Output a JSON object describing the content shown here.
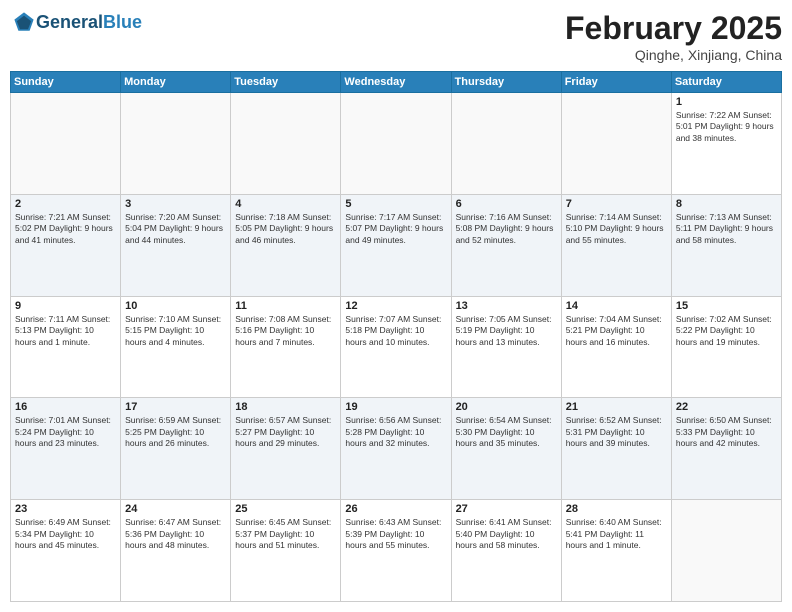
{
  "header": {
    "logo_general": "General",
    "logo_blue": "Blue",
    "month_title": "February 2025",
    "location": "Qinghe, Xinjiang, China"
  },
  "weekdays": [
    "Sunday",
    "Monday",
    "Tuesday",
    "Wednesday",
    "Thursday",
    "Friday",
    "Saturday"
  ],
  "weeks": [
    [
      {
        "day": "",
        "info": ""
      },
      {
        "day": "",
        "info": ""
      },
      {
        "day": "",
        "info": ""
      },
      {
        "day": "",
        "info": ""
      },
      {
        "day": "",
        "info": ""
      },
      {
        "day": "",
        "info": ""
      },
      {
        "day": "1",
        "info": "Sunrise: 7:22 AM\nSunset: 5:01 PM\nDaylight: 9 hours and 38 minutes."
      }
    ],
    [
      {
        "day": "2",
        "info": "Sunrise: 7:21 AM\nSunset: 5:02 PM\nDaylight: 9 hours and 41 minutes."
      },
      {
        "day": "3",
        "info": "Sunrise: 7:20 AM\nSunset: 5:04 PM\nDaylight: 9 hours and 44 minutes."
      },
      {
        "day": "4",
        "info": "Sunrise: 7:18 AM\nSunset: 5:05 PM\nDaylight: 9 hours and 46 minutes."
      },
      {
        "day": "5",
        "info": "Sunrise: 7:17 AM\nSunset: 5:07 PM\nDaylight: 9 hours and 49 minutes."
      },
      {
        "day": "6",
        "info": "Sunrise: 7:16 AM\nSunset: 5:08 PM\nDaylight: 9 hours and 52 minutes."
      },
      {
        "day": "7",
        "info": "Sunrise: 7:14 AM\nSunset: 5:10 PM\nDaylight: 9 hours and 55 minutes."
      },
      {
        "day": "8",
        "info": "Sunrise: 7:13 AM\nSunset: 5:11 PM\nDaylight: 9 hours and 58 minutes."
      }
    ],
    [
      {
        "day": "9",
        "info": "Sunrise: 7:11 AM\nSunset: 5:13 PM\nDaylight: 10 hours and 1 minute."
      },
      {
        "day": "10",
        "info": "Sunrise: 7:10 AM\nSunset: 5:15 PM\nDaylight: 10 hours and 4 minutes."
      },
      {
        "day": "11",
        "info": "Sunrise: 7:08 AM\nSunset: 5:16 PM\nDaylight: 10 hours and 7 minutes."
      },
      {
        "day": "12",
        "info": "Sunrise: 7:07 AM\nSunset: 5:18 PM\nDaylight: 10 hours and 10 minutes."
      },
      {
        "day": "13",
        "info": "Sunrise: 7:05 AM\nSunset: 5:19 PM\nDaylight: 10 hours and 13 minutes."
      },
      {
        "day": "14",
        "info": "Sunrise: 7:04 AM\nSunset: 5:21 PM\nDaylight: 10 hours and 16 minutes."
      },
      {
        "day": "15",
        "info": "Sunrise: 7:02 AM\nSunset: 5:22 PM\nDaylight: 10 hours and 19 minutes."
      }
    ],
    [
      {
        "day": "16",
        "info": "Sunrise: 7:01 AM\nSunset: 5:24 PM\nDaylight: 10 hours and 23 minutes."
      },
      {
        "day": "17",
        "info": "Sunrise: 6:59 AM\nSunset: 5:25 PM\nDaylight: 10 hours and 26 minutes."
      },
      {
        "day": "18",
        "info": "Sunrise: 6:57 AM\nSunset: 5:27 PM\nDaylight: 10 hours and 29 minutes."
      },
      {
        "day": "19",
        "info": "Sunrise: 6:56 AM\nSunset: 5:28 PM\nDaylight: 10 hours and 32 minutes."
      },
      {
        "day": "20",
        "info": "Sunrise: 6:54 AM\nSunset: 5:30 PM\nDaylight: 10 hours and 35 minutes."
      },
      {
        "day": "21",
        "info": "Sunrise: 6:52 AM\nSunset: 5:31 PM\nDaylight: 10 hours and 39 minutes."
      },
      {
        "day": "22",
        "info": "Sunrise: 6:50 AM\nSunset: 5:33 PM\nDaylight: 10 hours and 42 minutes."
      }
    ],
    [
      {
        "day": "23",
        "info": "Sunrise: 6:49 AM\nSunset: 5:34 PM\nDaylight: 10 hours and 45 minutes."
      },
      {
        "day": "24",
        "info": "Sunrise: 6:47 AM\nSunset: 5:36 PM\nDaylight: 10 hours and 48 minutes."
      },
      {
        "day": "25",
        "info": "Sunrise: 6:45 AM\nSunset: 5:37 PM\nDaylight: 10 hours and 51 minutes."
      },
      {
        "day": "26",
        "info": "Sunrise: 6:43 AM\nSunset: 5:39 PM\nDaylight: 10 hours and 55 minutes."
      },
      {
        "day": "27",
        "info": "Sunrise: 6:41 AM\nSunset: 5:40 PM\nDaylight: 10 hours and 58 minutes."
      },
      {
        "day": "28",
        "info": "Sunrise: 6:40 AM\nSunset: 5:41 PM\nDaylight: 11 hours and 1 minute."
      },
      {
        "day": "",
        "info": ""
      }
    ]
  ]
}
